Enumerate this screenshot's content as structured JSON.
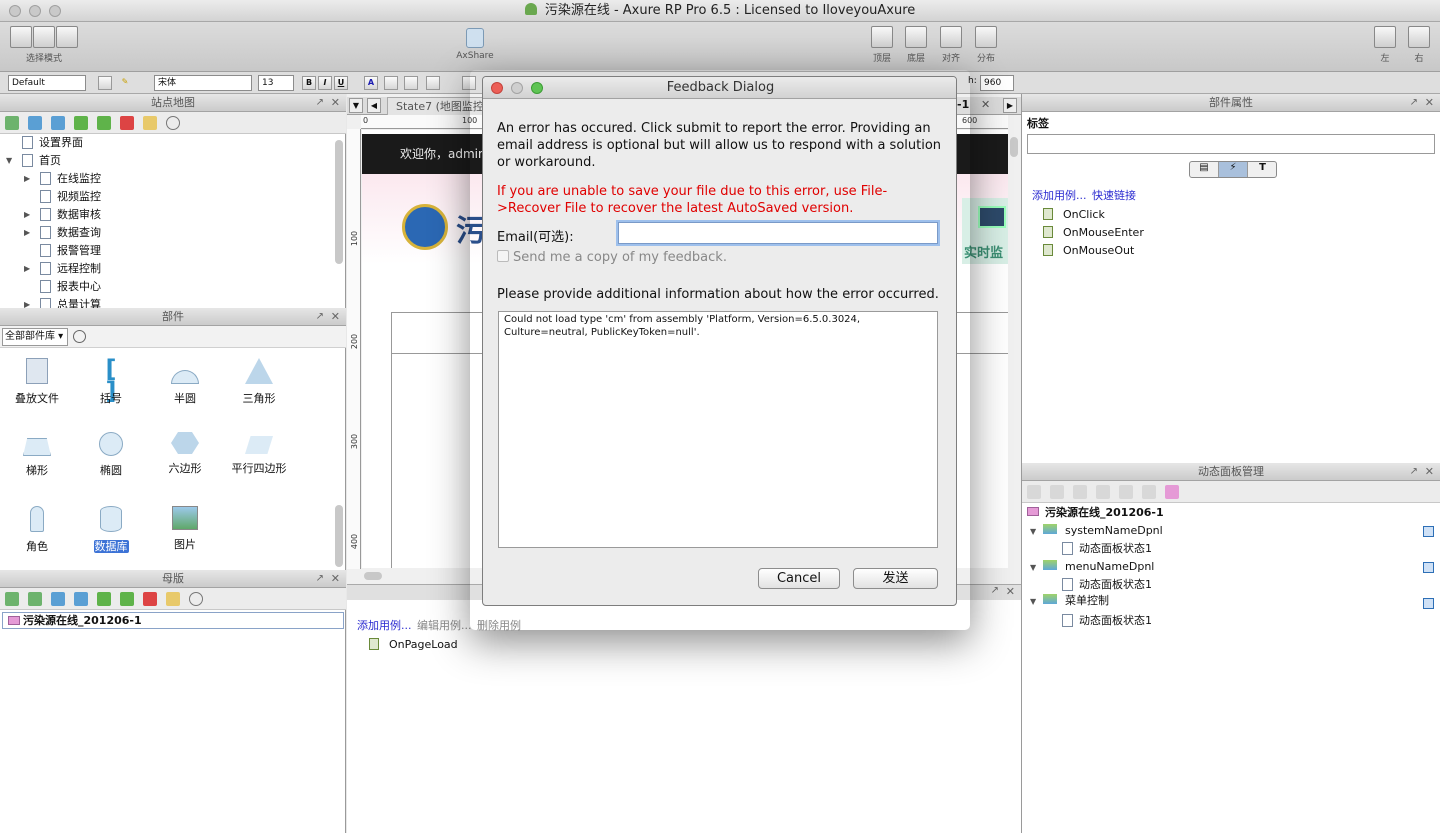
{
  "window": {
    "title": "污染源在线 - Axure RP Pro 6.5 : Licensed to IloveyouAxure"
  },
  "toolbar": {
    "select_mode": "选择模式",
    "axshare": "AxShare",
    "top_layer": "顶层",
    "bottom_layer": "底层",
    "align": "对齐",
    "distribute": "分布",
    "left": "左",
    "right": "右"
  },
  "formatbar": {
    "style": "Default",
    "font": "宋体",
    "size": "13",
    "bold": "B",
    "italic": "I",
    "underline": "U",
    "h_label": "h:",
    "h_value": "960"
  },
  "sitemap": {
    "title": "站点地图",
    "items": [
      {
        "label": "设置界面"
      },
      {
        "label": "首页"
      },
      {
        "label": "在线监控"
      },
      {
        "label": "视频监控"
      },
      {
        "label": "数据审核"
      },
      {
        "label": "数据查询"
      },
      {
        "label": "报警管理"
      },
      {
        "label": "远程控制"
      },
      {
        "label": "报表中心"
      },
      {
        "label": "总量计算"
      }
    ]
  },
  "widgets": {
    "title": "部件",
    "library": "全部部件库",
    "items": [
      {
        "label": "叠放文件"
      },
      {
        "label": "括号"
      },
      {
        "label": "半圆"
      },
      {
        "label": "三角形"
      },
      {
        "label": "梯形"
      },
      {
        "label": "椭圆"
      },
      {
        "label": "六边形"
      },
      {
        "label": "平行四边形"
      },
      {
        "label": "角色"
      },
      {
        "label": "数据库"
      },
      {
        "label": "图片"
      }
    ]
  },
  "masters": {
    "title": "母版",
    "item": "污染源在线_201206-1"
  },
  "canvas": {
    "tab": "State7 (地图监控",
    "tab_suffix": "-1",
    "welcome": "欢迎你，admin",
    "banner_char": "污",
    "realtime": "实时监",
    "ruler_h": [
      "0",
      "100",
      "600"
    ],
    "ruler_v": [
      "100",
      "200",
      "300",
      "400"
    ]
  },
  "page_interactions": {
    "add_case": "添加用例...",
    "edit_case": "编辑用例...",
    "delete_case": "删除用例",
    "event": "OnPageLoad"
  },
  "props": {
    "title": "部件属性",
    "label_heading": "标签",
    "add_case": "添加用例...",
    "quick_link": "快速链接",
    "events": [
      "OnClick",
      "OnMouseEnter",
      "OnMouseOut"
    ]
  },
  "dynpanel": {
    "title": "动态面板管理",
    "root": "污染源在线_201206-1",
    "panels": [
      {
        "name": "systemNameDpnl",
        "state": "动态面板状态1"
      },
      {
        "name": "menuNameDpnl",
        "state": "动态面板状态1"
      },
      {
        "name": "菜单控制",
        "state": "动态面板状态1"
      }
    ]
  },
  "dialog": {
    "title": "Feedback Dialog",
    "intro": "An error has occured. Click submit to report the error. Providing an email address is optional but will allow us to respond with a solution or workaround.",
    "warning": "If you are unable to save your file due to this error, use File->Recover File to recover the latest AutoSaved version.",
    "email_label": "Email(可选):",
    "email_value": "",
    "copy_label": "Send me a copy of my feedback.",
    "info_label": "Please provide additional information about how the error occurred.",
    "info_text": "Could not load type 'cm' from assembly 'Platform, Version=6.5.0.3024, Culture=neutral, PublicKeyToken=null'.",
    "cancel": "Cancel",
    "send": "发送",
    "warning_color": "#e00000"
  }
}
